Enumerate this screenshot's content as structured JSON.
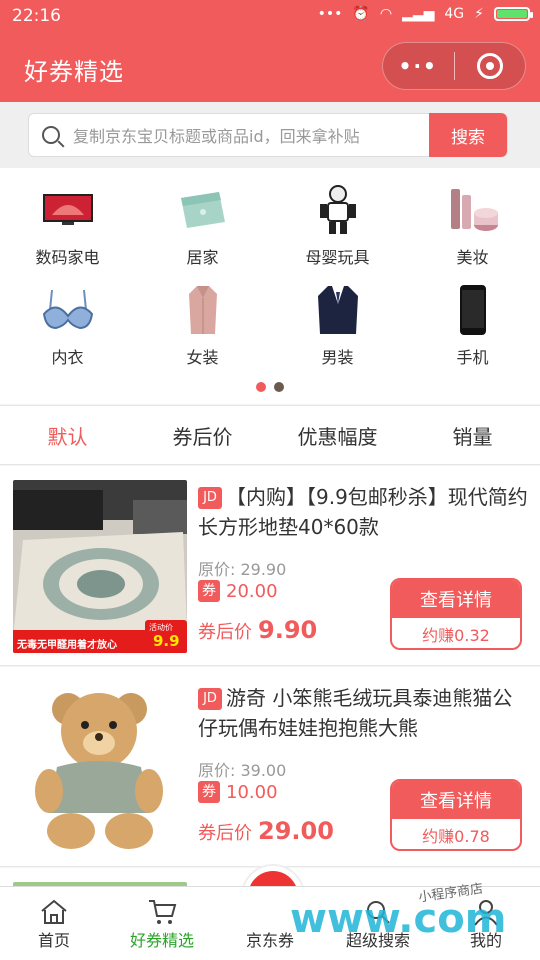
{
  "status_bar": {
    "time": "22:16",
    "network": "4G"
  },
  "header": {
    "title": "好券精选"
  },
  "search": {
    "placeholder": "复制京东宝贝标题或商品id，回来拿补贴",
    "button": "搜索"
  },
  "categories": [
    {
      "label": "数码家电",
      "icon": "tv-icon"
    },
    {
      "label": "居家",
      "icon": "towel-icon"
    },
    {
      "label": "母婴玩具",
      "icon": "robot-toy-icon"
    },
    {
      "label": "美妆",
      "icon": "cosmetics-icon"
    },
    {
      "label": "内衣",
      "icon": "bra-icon"
    },
    {
      "label": "女装",
      "icon": "coat-icon"
    },
    {
      "label": "男装",
      "icon": "suit-icon"
    },
    {
      "label": "手机",
      "icon": "phone-icon"
    }
  ],
  "pager": {
    "pages": 2,
    "active": 1
  },
  "sort_tabs": [
    {
      "label": "默认",
      "active": true
    },
    {
      "label": "券后价"
    },
    {
      "label": "优惠幅度"
    },
    {
      "label": "销量"
    }
  ],
  "products": [
    {
      "badge": "JD",
      "title": "【内购】【9.9包邮秒杀】现代简约长方形地垫40*60款",
      "original_price": "原价: 29.90",
      "coupon_tag": "券",
      "coupon": "20.00",
      "after_label": "券后价",
      "after_price": "9.90",
      "detail_label": "查看详情",
      "earn": "约赚0.32",
      "banner": "无毒无甲醛用着才放心",
      "banner_price_label": "活动价",
      "banner_price": "9.9"
    },
    {
      "badge": "JD",
      "title": "游奇 小笨熊毛绒玩具泰迪熊猫公仔玩偶布娃娃抱抱熊大熊",
      "original_price": "原价: 39.00",
      "coupon_tag": "券",
      "coupon": "10.00",
      "after_label": "券后价",
      "after_price": "29.00",
      "detail_label": "查看详情",
      "earn": "约赚0.78"
    }
  ],
  "tabbar": [
    {
      "label": "首页",
      "icon": "home-icon"
    },
    {
      "label": "好券精选",
      "icon": "cart-icon",
      "active": true
    },
    {
      "label": "京东券",
      "icon": "jd-mascot-icon"
    },
    {
      "label": "超级搜索",
      "icon": "search-icon"
    },
    {
      "label": "我的",
      "icon": "user-icon"
    }
  ],
  "jd_bubble": {
    "text": "京东"
  },
  "watermark": {
    "text": "小程序商店",
    "brand": "www.com"
  },
  "colors": {
    "primary": "#f25b5b",
    "active_tab": "#2aa52a"
  }
}
